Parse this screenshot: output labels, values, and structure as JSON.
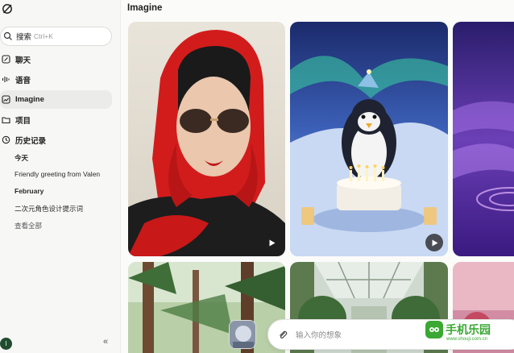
{
  "sidebar": {
    "search": {
      "label": "搜索",
      "shortcut": "Ctrl+K"
    },
    "nav": [
      {
        "label": "聊天",
        "icon": "chat-icon"
      },
      {
        "label": "语音",
        "icon": "voice-icon"
      },
      {
        "label": "Imagine",
        "icon": "imagine-icon"
      },
      {
        "label": "项目",
        "icon": "folder-icon"
      },
      {
        "label": "历史记录",
        "icon": "history-icon"
      }
    ],
    "history": [
      {
        "label": "今天",
        "kind": "head"
      },
      {
        "label": "Friendly greeting from Valen",
        "kind": "item"
      },
      {
        "label": "February",
        "kind": "head"
      },
      {
        "label": "二次元角色设计提示词",
        "kind": "item"
      },
      {
        "label": "查看全部",
        "kind": "muted"
      }
    ],
    "avatar_letter": "I",
    "collapse_glyph": "«"
  },
  "main": {
    "title": "Imagine",
    "prompt": {
      "placeholder": "输入你的想象"
    }
  },
  "watermark": {
    "brand": "手机乐园",
    "url": "www.shouji.com.cn"
  },
  "colors": {
    "accent": "#3aa832",
    "sidebar_bg": "#f7f7f6",
    "active_bg": "#ebebe9"
  }
}
